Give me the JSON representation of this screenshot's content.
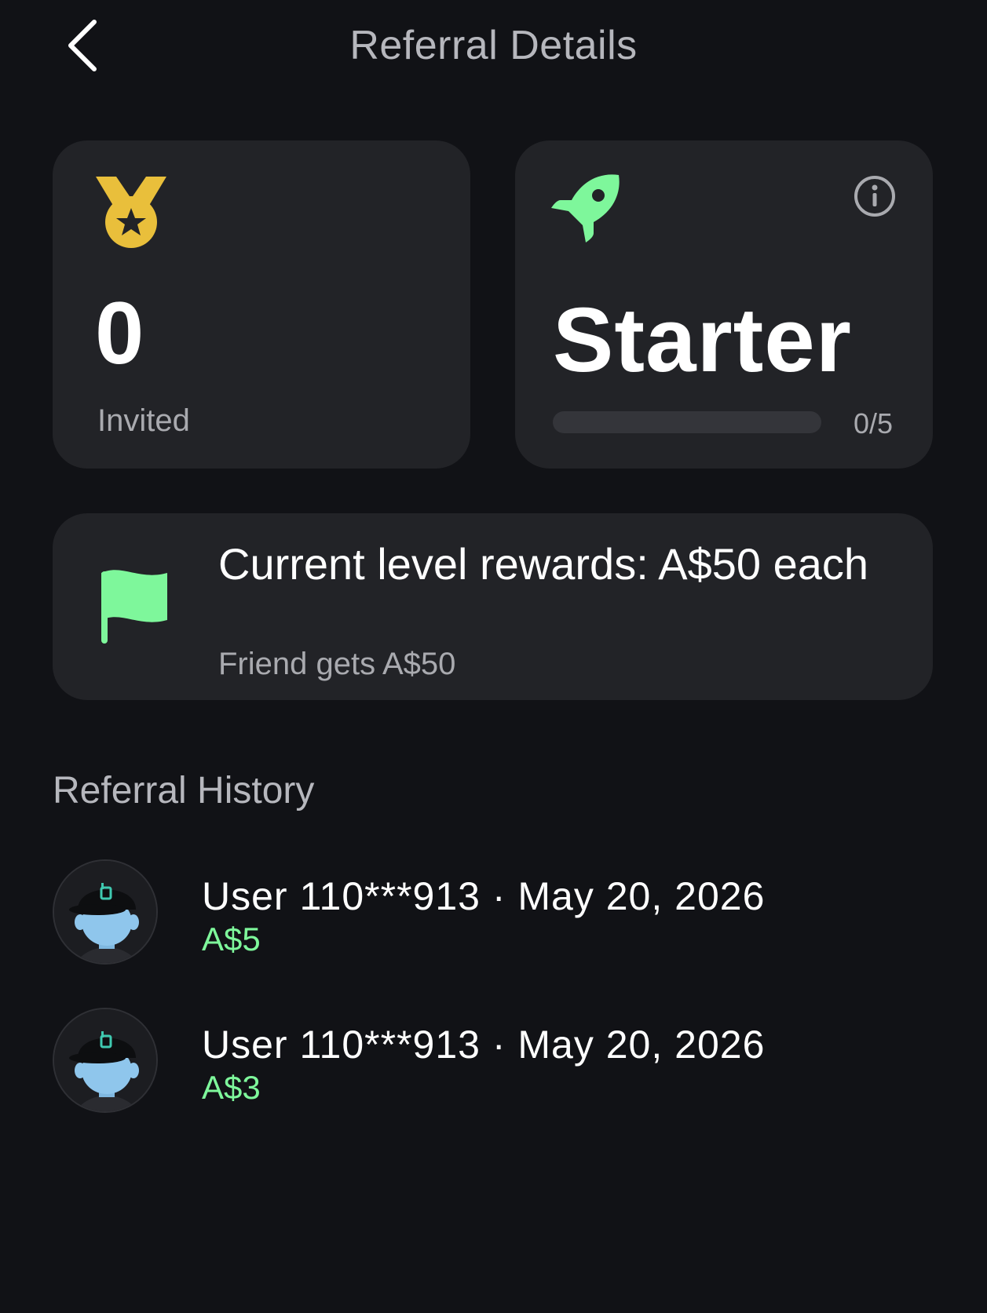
{
  "header": {
    "title": "Referral Details",
    "back_icon": "chevron-left-icon"
  },
  "invited_card": {
    "icon": "medal-icon",
    "count": "0",
    "label": "Invited"
  },
  "level_card": {
    "icon": "rocket-icon",
    "info_icon": "info-icon",
    "level_name": "Starter",
    "progress_text": "0/5",
    "progress_fraction": 0
  },
  "rewards_card": {
    "icon": "flag-icon",
    "title": "Current level rewards: A$50 each",
    "subtitle": "Friend gets A$50"
  },
  "history": {
    "title": "Referral History",
    "items": [
      {
        "text": "User 110***913 · May 20, 2026",
        "amount": "A$5"
      },
      {
        "text": "User 110***913 · May 20, 2026",
        "amount": "A$3"
      }
    ]
  },
  "colors": {
    "background": "#111216",
    "card": "#222327",
    "accent_green": "#7ef79b",
    "medal_gold": "#e9bf3b",
    "muted_text": "#a9aaaf"
  }
}
